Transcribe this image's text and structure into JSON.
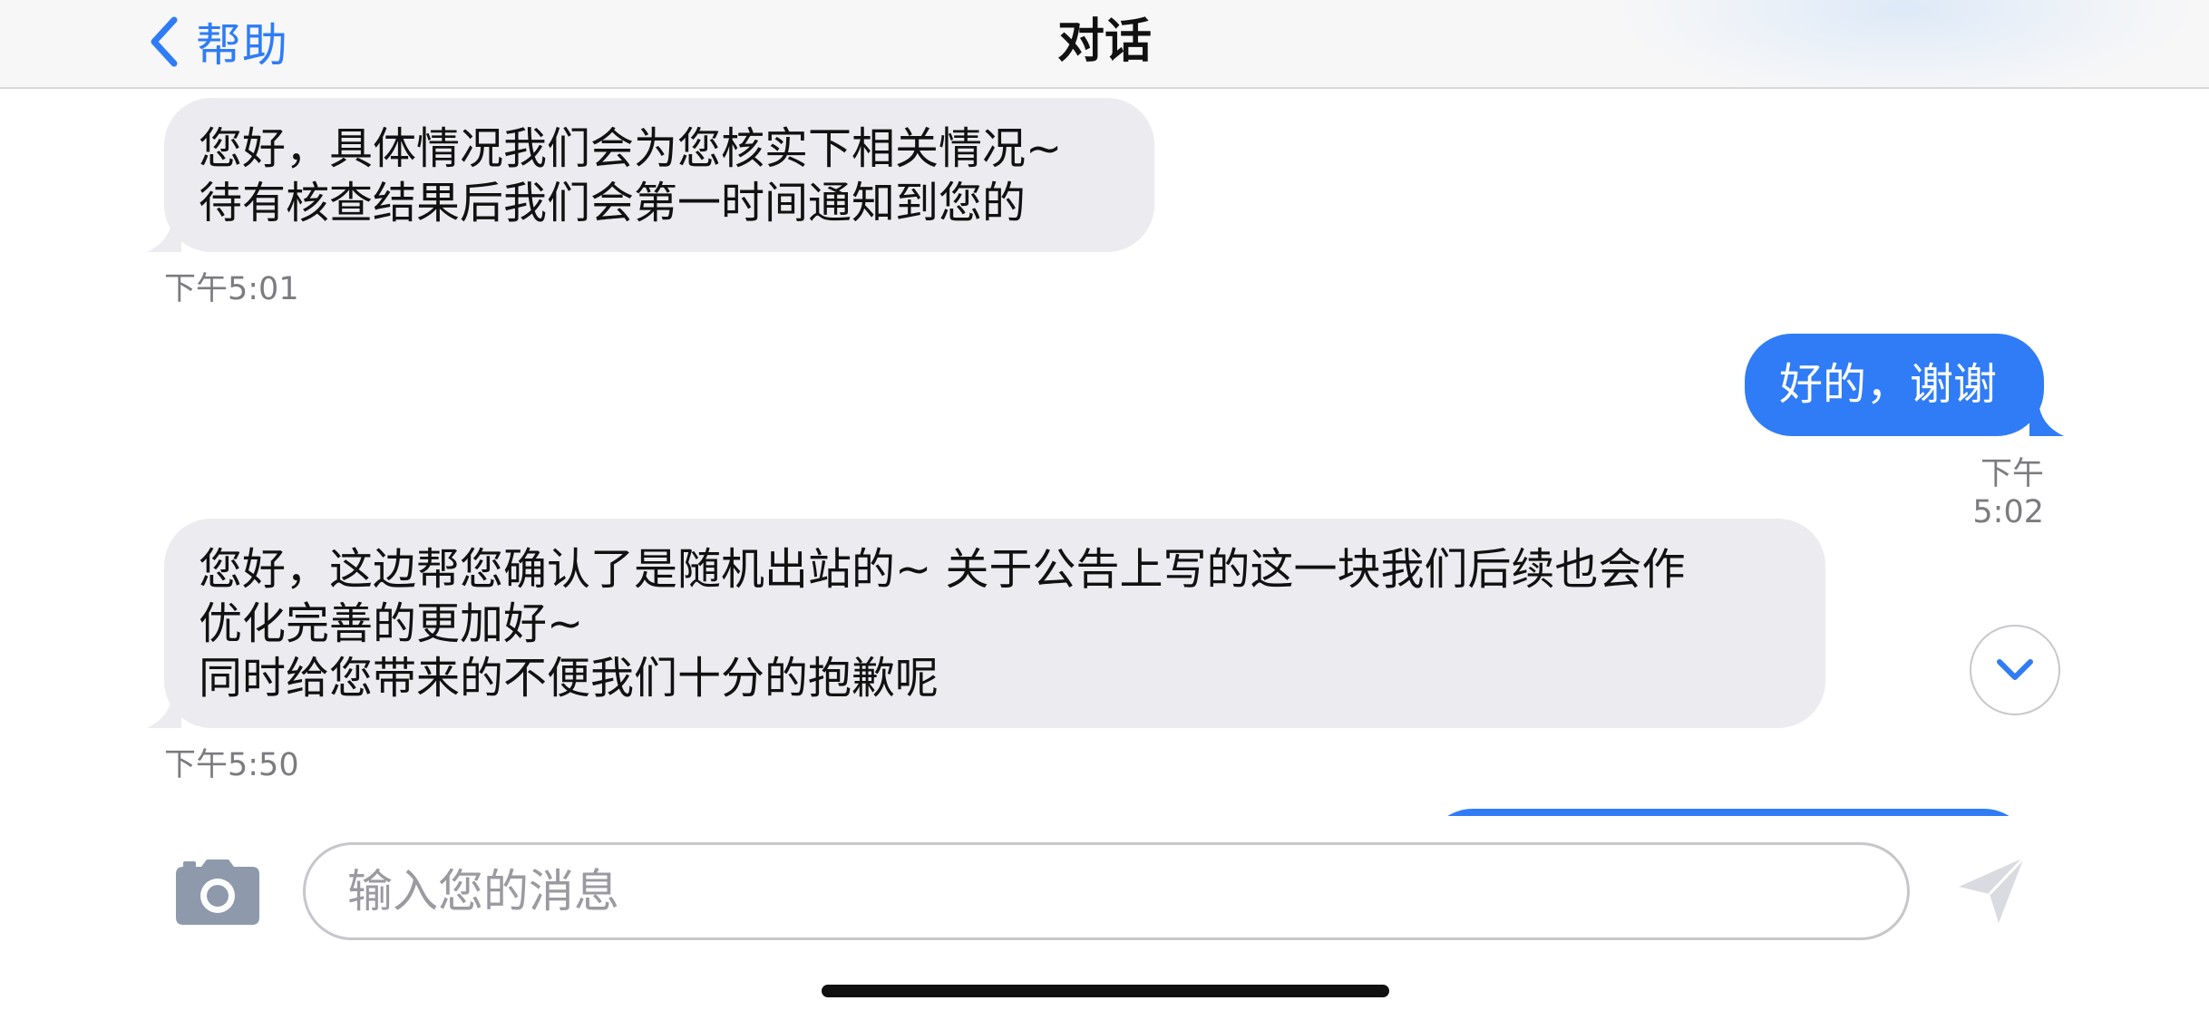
{
  "header": {
    "back_label": "帮助",
    "title": "对话"
  },
  "messages": [
    {
      "direction": "incoming",
      "lines": [
        "您好，具体情况我们会为您核实下相关情况~",
        "待有核查结果后我们会第一时间通知到您的"
      ],
      "time": "下午5:01"
    },
    {
      "direction": "outgoing",
      "lines": [
        "好的，谢谢"
      ],
      "time": "下午5:02"
    },
    {
      "direction": "incoming",
      "lines": [
        "您好，这边帮您确认了是随机出站的~ 关于公告上写的这一块我们后续也会作",
        "优化完善的更加好~",
        "同时给您带来的不便我们十分的抱歉呢"
      ],
      "time": "下午5:50"
    }
  ],
  "composer": {
    "placeholder": "输入您的消息"
  },
  "icons": {
    "back": "chevron-left-icon",
    "scroll": "chevron-down-icon",
    "camera": "camera-icon",
    "send": "send-icon"
  },
  "colors": {
    "accent": "#2f7cf6",
    "incoming_bubble": "#ebebf0",
    "timestamp": "#7b7b80"
  }
}
